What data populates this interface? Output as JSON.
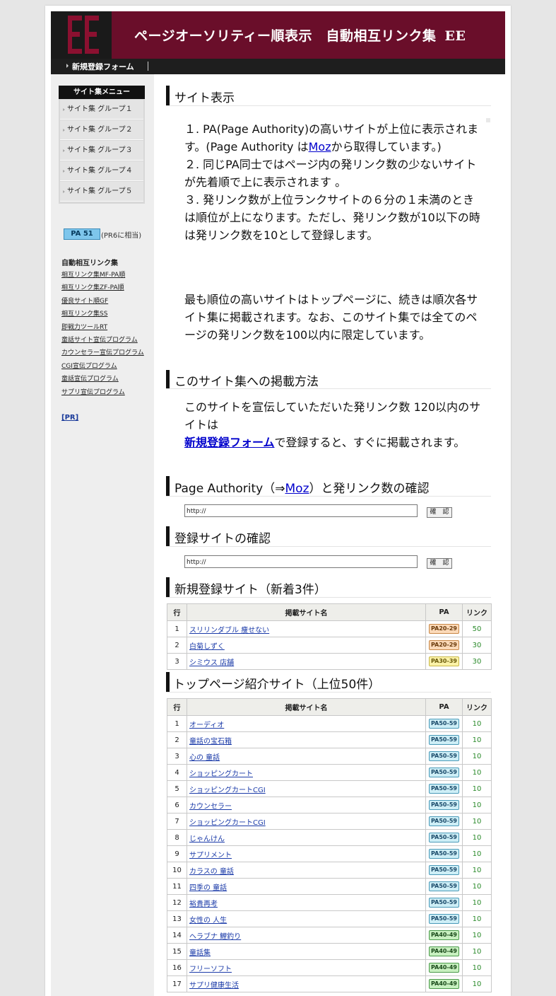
{
  "header": {
    "logo_text": "EE",
    "title": "ページオーソリティー順表示　自動相互リンク集",
    "title_suffix": "EE"
  },
  "nav": {
    "register_link": "新規登録フォーム"
  },
  "sidebar": {
    "menu_title": "サイト集メニュー",
    "menu_items": [
      "サイト集 グループ１",
      "サイト集 グループ２",
      "サイト集 グループ３",
      "サイト集 グループ４",
      "サイト集 グループ５"
    ],
    "pa_badge": "PA 51",
    "pa_note": "(PR6に相当)",
    "links_heading": "自動相互リンク集",
    "links": [
      "相互リンク集MF-PA順",
      "相互リンク集ZF-PA順",
      "優良サイト順GF",
      "相互リンク集SS",
      "即戦力ツールRT",
      "童話サイト宣伝プログラム",
      "カウンセラー宣伝プログラム",
      "CGI宣伝プログラム",
      "童話宣伝プログラム",
      "サプリ宣伝プログラム"
    ],
    "pr_link": "[PR]"
  },
  "sections": {
    "site_display": {
      "title": "サイト表示",
      "p1": "１. PA(Page Authority)の高いサイトが上位に表示されます。(Page Authority は",
      "p1_link": "Moz",
      "p1_tail": "から取得しています。)",
      "p2": "２. 同じPA同士ではページ内の発リンク数の少ないサイトが先着順で上に表示されます 。",
      "p3": "３. 発リンク数が上位ランクサイトの６分の１未満のときは順位が上になります。ただし、発リンク数が10以下の時は発リンク数を10として登録します。",
      "p4": "最も順位の高いサイトはトップページに、続きは順次各サイト集に掲載されます。なお、このサイト集では全てのページの発リンク数を100以内に限定しています。"
    },
    "how_to": {
      "title": "このサイト集への掲載方法",
      "p1": "このサイトを宣伝していただいた発リンク数 120以内のサイトは",
      "p1_link": "新規登録フォーム",
      "p1_tail": "で登録すると、すぐに掲載されます。"
    },
    "pa_check": {
      "title_pre": "Page Authority（⇒",
      "title_link": "Moz",
      "title_post": "）と発リンク数の確認",
      "input_value": "http://",
      "button_label": "確　認"
    },
    "site_check": {
      "title": "登録サイトの確認",
      "input_value": "http://",
      "button_label": "確　認"
    },
    "new_sites": {
      "title": "新規登録サイト（新着3件）",
      "headers": [
        "行",
        "掲載サイト名",
        "PA",
        "リンク"
      ],
      "rows": [
        {
          "n": "1",
          "name": "スリリンダブル 痩せない",
          "pa": "PA20-29",
          "links": "50"
        },
        {
          "n": "2",
          "name": "白菊しずく",
          "pa": "PA20-29",
          "links": "30"
        },
        {
          "n": "3",
          "name": "シミウス 店舗",
          "pa": "PA30-39",
          "links": "30"
        }
      ]
    },
    "top_sites": {
      "title": "トップページ紹介サイト（上位50件）",
      "headers": [
        "行",
        "掲載サイト名",
        "PA",
        "リンク"
      ],
      "rows": [
        {
          "n": "1",
          "name": "オーディオ",
          "pa": "PA50-59",
          "links": "10"
        },
        {
          "n": "2",
          "name": "童話の宝石箱",
          "pa": "PA50-59",
          "links": "10"
        },
        {
          "n": "3",
          "name": "心の 童話",
          "pa": "PA50-59",
          "links": "10"
        },
        {
          "n": "4",
          "name": "ショッピングカート",
          "pa": "PA50-59",
          "links": "10"
        },
        {
          "n": "5",
          "name": "ショッピングカートCGI",
          "pa": "PA50-59",
          "links": "10"
        },
        {
          "n": "6",
          "name": "カウンセラー",
          "pa": "PA50-59",
          "links": "10"
        },
        {
          "n": "7",
          "name": "ショッピングカートCGI",
          "pa": "PA50-59",
          "links": "10"
        },
        {
          "n": "8",
          "name": "じゃんけん",
          "pa": "PA50-59",
          "links": "10"
        },
        {
          "n": "9",
          "name": "サプリメント",
          "pa": "PA50-59",
          "links": "10"
        },
        {
          "n": "10",
          "name": "カラスの 童話",
          "pa": "PA50-59",
          "links": "10"
        },
        {
          "n": "11",
          "name": "四季の 童話",
          "pa": "PA50-59",
          "links": "10"
        },
        {
          "n": "12",
          "name": "裕貴再考",
          "pa": "PA50-59",
          "links": "10"
        },
        {
          "n": "13",
          "name": "女性の 人生",
          "pa": "PA50-59",
          "links": "10"
        },
        {
          "n": "14",
          "name": "ヘラブナ 鯉釣り",
          "pa": "PA40-49",
          "links": "10"
        },
        {
          "n": "15",
          "name": "童話集",
          "pa": "PA40-49",
          "links": "10"
        },
        {
          "n": "16",
          "name": "フリーソフト",
          "pa": "PA40-49",
          "links": "10"
        },
        {
          "n": "17",
          "name": "サプリ健康生活",
          "pa": "PA40-49",
          "links": "10"
        }
      ]
    }
  },
  "colors": {
    "header_bg": "#6a0e2a",
    "nav_bg": "#1e1e1e",
    "link": "#0000cc"
  }
}
